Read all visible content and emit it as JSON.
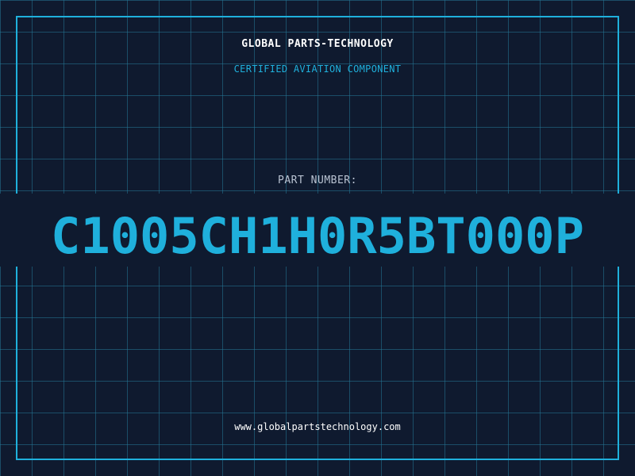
{
  "header": {
    "company": "GLOBAL PARTS-TECHNOLOGY",
    "tagline": "CERTIFIED AVIATION COMPONENT"
  },
  "part": {
    "label": "PART NUMBER:",
    "number": "C1005CH1H0R5BT000P"
  },
  "footer": {
    "url": "www.globalpartstechnology.com"
  },
  "colors": {
    "background": "#0f1a2f",
    "accent": "#1fb0dc",
    "grid": "#247696",
    "text": "#ffffff"
  }
}
